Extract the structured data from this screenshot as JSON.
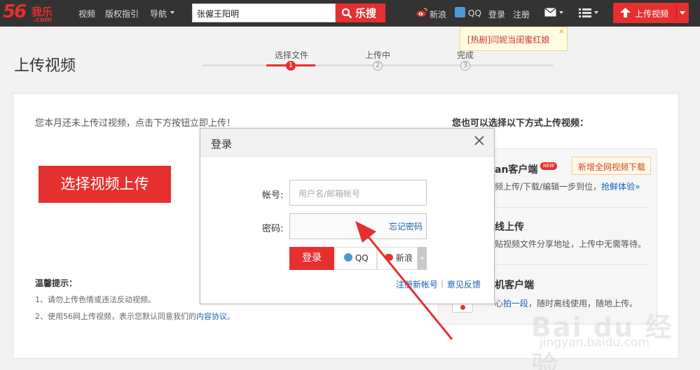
{
  "topbar": {
    "logo": {
      "num": "56",
      "name": "我乐",
      "domain": ".com"
    },
    "nav": [
      "视频",
      "版权指引",
      "导航"
    ],
    "search": {
      "value": "张僱王阳明",
      "button": "乐搜"
    },
    "links": {
      "weibo": "新浪",
      "qq": "QQ",
      "login": "登录",
      "register": "注册"
    },
    "upload_button": "上传视频"
  },
  "hot_tip": {
    "text": "[热剧]闫妮当闺蜜红娘",
    "close": "×"
  },
  "page": {
    "title": "上传视频"
  },
  "steps": [
    {
      "label": "选择文件",
      "num": "1"
    },
    {
      "label": "上传中",
      "num": "2"
    },
    {
      "label": "完成",
      "num": "3"
    }
  ],
  "left": {
    "intro": "您本月还未上传过视频，点击下方按钮立即上传！",
    "select_button": "选择视频上传",
    "tips_title": "温馨提示：",
    "tip1": "1、请勿上传色情或违法反动视频。",
    "tip2_prefix": "2、使用56网上传视频，表示您默认同意我们的",
    "tip2_link": "内容协议",
    "tip2_suffix": "。"
  },
  "right": {
    "title": "您也可以选择以下方式上传视频：",
    "opt1_title": "an客户端",
    "opt1_badge": "NEW",
    "opt1_tag": "新增全网视频下载",
    "opt1_desc": "频上传/下载/编辑一步到位，",
    "opt1_link": "抢鲜体验»",
    "opt2_title": "线上传",
    "opt2_desc": "贴视频文件分享地址，上传中无需等待。",
    "opt3_title": "机客户端",
    "opt3_desc_a": "心",
    "opt3_link": "拍一段",
    "opt3_desc_b": "，随时离线使用，随地上传。"
  },
  "dialog": {
    "title": "登录",
    "account_label": "帐号:",
    "account_placeholder": "用户名/邮箱帐号",
    "password_label": "密码:",
    "forgot": "忘记密码",
    "login_button": "登录",
    "qq": "QQ",
    "weibo": "新浪",
    "more": "»",
    "register": "注册新帐号",
    "separator": "|",
    "feedback": "意见反馈"
  },
  "watermark": {
    "main": "Bai du 经验",
    "sub": "jingyan.baidu.com"
  },
  "colors": {
    "brand_red": "#e6302f",
    "topbar": "#333333",
    "link_blue": "#1a5fb4"
  },
  "icons": [
    "search-icon",
    "weibo-icon",
    "qq-icon",
    "mail-icon",
    "menu-list-icon",
    "upload-arrow-icon",
    "close-icon",
    "phone-icon"
  ]
}
